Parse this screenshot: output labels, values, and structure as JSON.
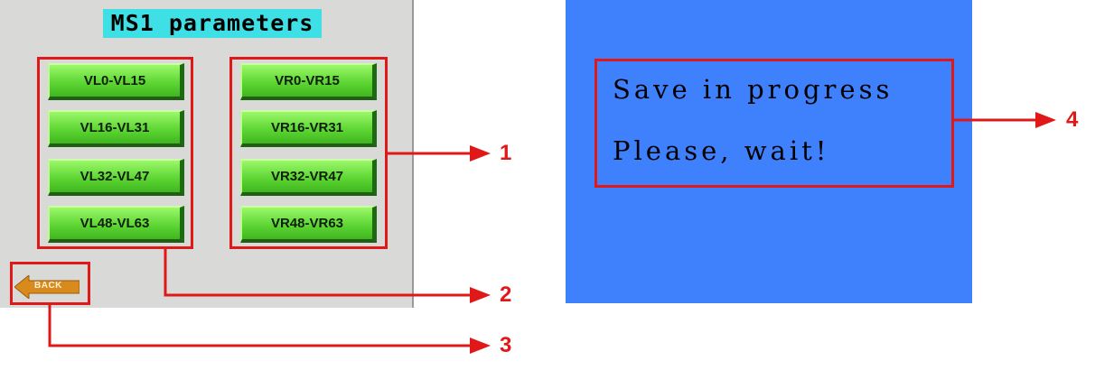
{
  "left_screen": {
    "title": "MS1 parameters",
    "left_buttons": [
      "VL0-VL15",
      "VL16-VL31",
      "VL32-VL47",
      "VL48-VL63"
    ],
    "right_buttons": [
      "VR0-VR15",
      "VR16-VR31",
      "VR32-VR47",
      "VR48-VR63"
    ],
    "back_label": "BACK"
  },
  "right_screen": {
    "line1": "Save in progress",
    "line2": "Please, wait!"
  },
  "callouts": [
    "1",
    "2",
    "3",
    "4"
  ],
  "colors": {
    "highlight": "#e01818",
    "button_green": "#5ed634",
    "title_cyan": "#3ee0e6",
    "screen_blue": "#3f80fd",
    "screen_grey": "#d9dad8",
    "back_orange": "#d98a1c"
  },
  "icons": {
    "back": "left-arrow-icon",
    "pointer": "arrow-right-icon"
  }
}
